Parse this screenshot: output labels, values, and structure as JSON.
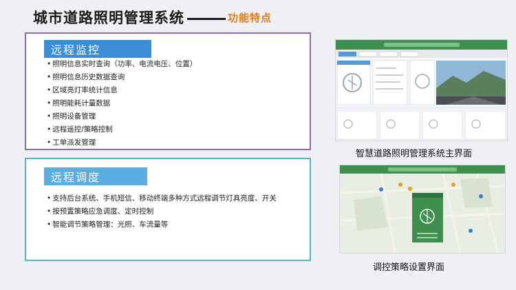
{
  "header": {
    "title": "城市道路照明管理系统",
    "subtitle": "功能特点"
  },
  "panels": [
    {
      "tag": "远程监控",
      "items": [
        "照明信息实时查询（功率、电流电压、位置）",
        "照明信息历史数据查询",
        "区域亮灯率统计信息",
        "照明能耗计量数据",
        "照明设备管理",
        "远程遥控/策略控制",
        "工单派发管理"
      ]
    },
    {
      "tag": "远程调度",
      "items": [
        "支持后台系统、手机短信、移动终端多种方式远程调节灯具亮度、开关",
        "按预置策略应急调度、定时控制",
        "智能调节策略管理：光照、车流量等"
      ]
    }
  ],
  "screenshots": [
    {
      "caption": "智慧道路照明管理系统主界面"
    },
    {
      "caption": "调控策略设置界面"
    }
  ],
  "colors": {
    "accent_orange": "#e07a1a",
    "tag_blue": "#3a8ed8",
    "border_purple": "#8c6bb1",
    "border_cyan": "#4fb3c9",
    "ui_green": "#3f8f4e"
  }
}
